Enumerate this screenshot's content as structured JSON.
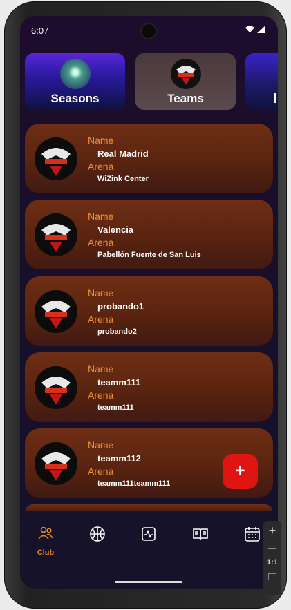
{
  "status": {
    "time": "6:07"
  },
  "tabs": [
    {
      "label": "Seasons"
    },
    {
      "label": "Teams"
    }
  ],
  "field_labels": {
    "name": "Name",
    "arena": "Arena"
  },
  "teams": [
    {
      "name": "Real Madrid",
      "arena": "WiZink Center"
    },
    {
      "name": "Valencia",
      "arena": "Pabellón Fuente de San Luis"
    },
    {
      "name": "probando1",
      "arena": "probando2"
    },
    {
      "name": "teamm111",
      "arena": "teamm111"
    },
    {
      "name": "teamm112",
      "arena": "teamm111teamm111"
    }
  ],
  "fab": {
    "label": "+"
  },
  "nav": [
    {
      "icon": "club-icon",
      "label": "Club"
    },
    {
      "icon": "basketball-icon"
    },
    {
      "icon": "activity-icon"
    },
    {
      "icon": "book-icon"
    },
    {
      "icon": "calendar-icon"
    }
  ],
  "zoom": {
    "plus": "+",
    "ratio": "1:1"
  },
  "colors": {
    "accent": "#f08a20",
    "fab": "#e01410"
  }
}
